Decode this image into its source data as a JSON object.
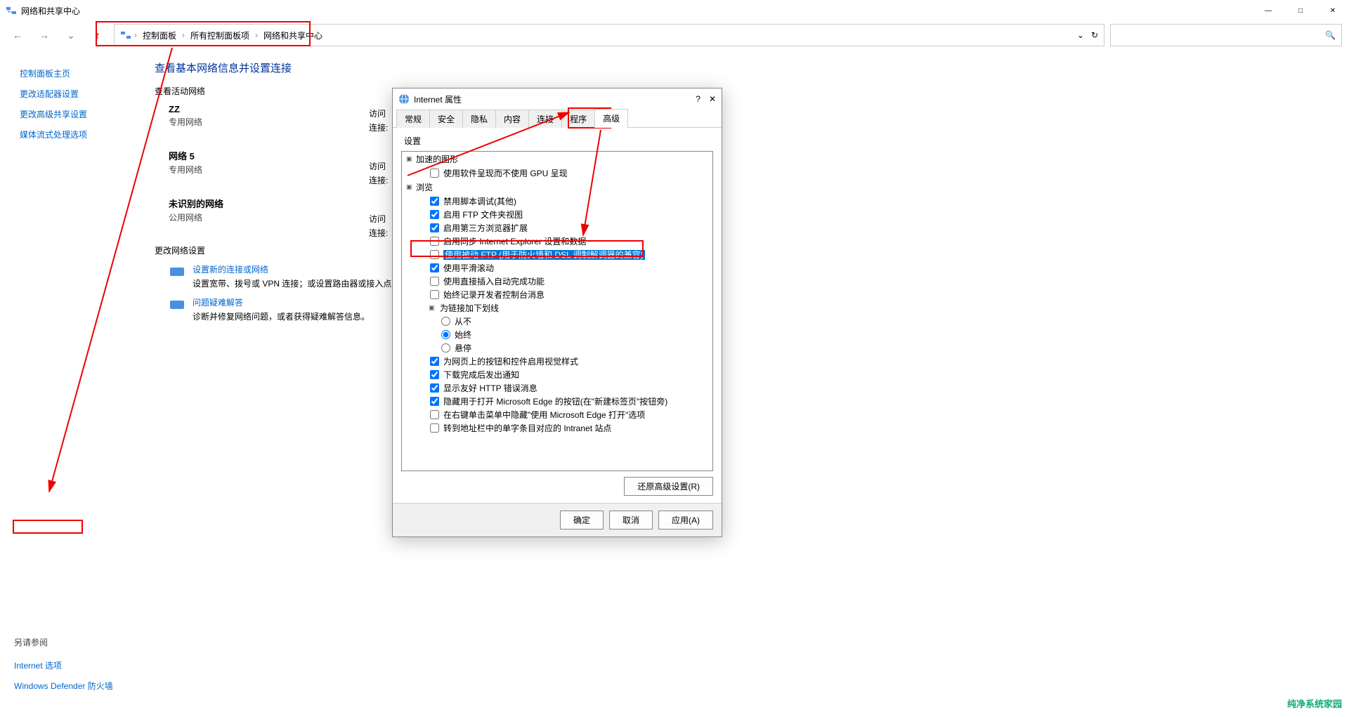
{
  "window": {
    "title": "网络和共享中心",
    "minimize": "—",
    "maximize": "□",
    "close": "✕"
  },
  "nav": {
    "back": "←",
    "forward": "→",
    "up": "↑",
    "dropdown": "⌄",
    "refresh": "↻",
    "search": "🔍"
  },
  "breadcrumb": {
    "seg1": "控制面板",
    "seg2": "所有控制面板项",
    "seg3": "网络和共享中心"
  },
  "sidebar": {
    "links": [
      "控制面板主页",
      "更改适配器设置",
      "更改高级共享设置",
      "媒体流式处理选项"
    ],
    "bottomHeading": "另请参阅",
    "bottomLinks": [
      "Internet 选项",
      "Windows Defender 防火墙"
    ]
  },
  "content": {
    "heading": "查看基本网络信息并设置连接",
    "viewActive": "查看活动网络",
    "networks": [
      {
        "name": "ZZ",
        "type": "专用网络",
        "access": "访问",
        "conn": "连接:"
      },
      {
        "name": "网络 5",
        "type": "专用网络",
        "access": "访问",
        "conn": "连接:"
      },
      {
        "name": "未识别的网络",
        "type": "公用网络",
        "access": "访问",
        "conn": "连接:"
      }
    ],
    "changeHeading": "更改网络设置",
    "tasks": [
      {
        "title": "设置新的连接或网络",
        "desc": "设置宽带、拨号或 VPN 连接；或设置路由器或接入点。"
      },
      {
        "title": "问题疑难解答",
        "desc": "诊断并修复网络问题，或者获得疑难解答信息。"
      }
    ]
  },
  "dialog": {
    "title": "Internet 属性",
    "help": "?",
    "close": "✕",
    "tabs": [
      "常规",
      "安全",
      "隐私",
      "内容",
      "连接",
      "程序",
      "高级"
    ],
    "activeTab": 6,
    "settingsLabel": "设置",
    "tree": {
      "group1": "加速的图形",
      "item1": {
        "label": "使用软件呈现而不使用 GPU 呈现",
        "checked": false
      },
      "group2": "浏览",
      "items2": [
        {
          "label": "禁用脚本调试(其他)",
          "checked": true
        },
        {
          "label": "启用 FTP 文件夹视图",
          "checked": true
        },
        {
          "label": "启用第三方浏览器扩展",
          "checked": true
        },
        {
          "label": "启用同步 Internet Explorer 设置和数据",
          "checked": false
        },
        {
          "label": "使用被动 FTP (用于防火墙和 DSL 调制解调器的兼容)",
          "checked": false,
          "selected": true
        },
        {
          "label": "使用平滑滚动",
          "checked": true
        },
        {
          "label": "使用直接插入自动完成功能",
          "checked": false
        },
        {
          "label": "始终记录开发者控制台消息",
          "checked": false
        }
      ],
      "subgroup": "为链接加下划线",
      "radios": [
        {
          "label": "从不",
          "selected": false
        },
        {
          "label": "始终",
          "selected": true
        },
        {
          "label": "悬停",
          "selected": false
        }
      ],
      "items3": [
        {
          "label": "为网页上的按钮和控件启用视觉样式",
          "checked": true
        },
        {
          "label": "下载完成后发出通知",
          "checked": true
        },
        {
          "label": "显示友好 HTTP 错误消息",
          "checked": true
        },
        {
          "label": "隐藏用于打开 Microsoft Edge 的按钮(在\"新建标签页\"按钮旁)",
          "checked": true
        },
        {
          "label": "在右键单击菜单中隐藏\"使用 Microsoft Edge 打开\"选项",
          "checked": false
        },
        {
          "label": "转到地址栏中的单字条目对应的 Intranet 站点",
          "checked": false
        }
      ]
    },
    "restoreBtn": "还原高级设置(R)",
    "buttons": {
      "ok": "确定",
      "cancel": "取消",
      "apply": "应用(A)"
    }
  },
  "logo": "纯净系统家园"
}
